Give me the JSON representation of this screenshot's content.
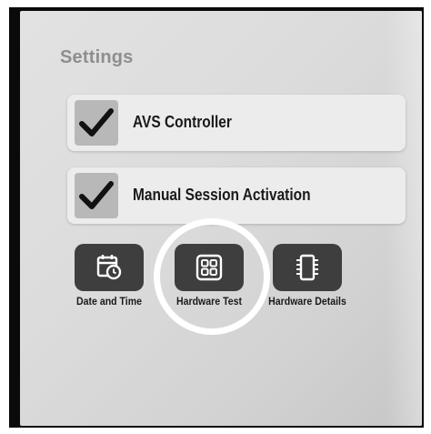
{
  "settings": {
    "title": "Settings"
  },
  "options": [
    {
      "label": "AVS Controller",
      "checked": true
    },
    {
      "label": "Manual Session Activation",
      "checked": true
    }
  ],
  "tiles": [
    {
      "label": "Date and Time",
      "icon": "calendar-clock-icon"
    },
    {
      "label": "Hardware Test",
      "icon": "grid-icon"
    },
    {
      "label": "Hardware Details",
      "icon": "chip-icon"
    }
  ],
  "colors": {
    "tile_background": "#3e3e3e",
    "highlight": "#ffffff"
  }
}
